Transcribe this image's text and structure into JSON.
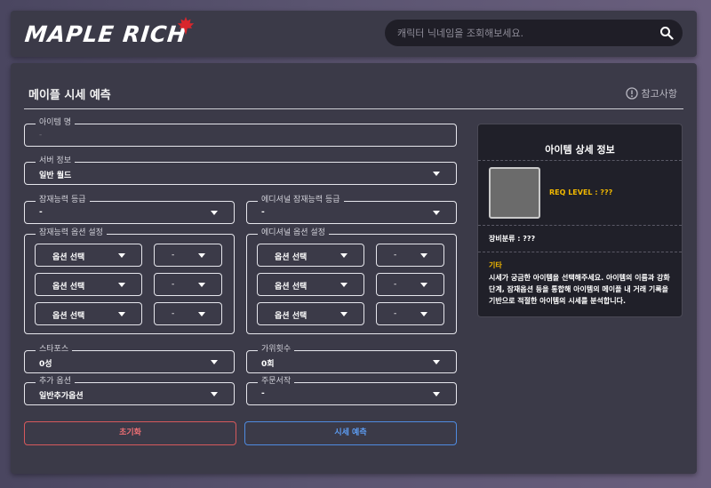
{
  "header": {
    "logo_text": "MAPLE RICH",
    "search": {
      "placeholder": "캐릭터 닉네임을 조회해보세요."
    }
  },
  "main": {
    "title": "메이플 시세 예측",
    "notice_label": "참고사항",
    "fields": {
      "item_name": {
        "label": "아이템 명",
        "value": "-"
      },
      "server": {
        "label": "서버 정보",
        "value": "일반 월드"
      },
      "potential_grade": {
        "label": "잠재능력 등급",
        "value": "-"
      },
      "additional_grade": {
        "label": "에디셔널 잠재능력 등급",
        "value": "-"
      },
      "starforce": {
        "label": "스타포스",
        "value": "0성"
      },
      "scissors": {
        "label": "가위횟수",
        "value": "0회"
      },
      "extra_option": {
        "label": "추가 옵션",
        "value": "일반추가옵션"
      },
      "scroll": {
        "label": "주문서작",
        "value": "-"
      }
    },
    "potential_group": {
      "label": "잠재능력 옵션 설정",
      "rows": [
        {
          "option": "옵션 선택",
          "value": "-"
        },
        {
          "option": "옵션 선택",
          "value": "-"
        },
        {
          "option": "옵션 선택",
          "value": "-"
        }
      ]
    },
    "additional_group": {
      "label": "에디셔널 옵션 설정",
      "rows": [
        {
          "option": "옵션 선택",
          "value": "-"
        },
        {
          "option": "옵션 선택",
          "value": "-"
        },
        {
          "option": "옵션 선택",
          "value": "-"
        }
      ]
    },
    "buttons": {
      "reset": "초기화",
      "predict": "시세 예측"
    }
  },
  "detail": {
    "title": "아이템 상세 정보",
    "req_level": "REQ LEVEL : ???",
    "equip_category": "장비분류 : ???",
    "etc_title": "기타",
    "etc_desc": "시세가 궁금한 아이템을 선택해주세요. 아이템의 이름과 강화 단계, 잠재옵션 등을 통합해 아이템의 메이플 내 거래 기록을 기반으로 적절한 아이템의 시세를 분석합니다."
  },
  "colors": {
    "accent_yellow": "#f1b800",
    "reset_red": "#ef6f74",
    "predict_blue": "#5c9cf2",
    "panel_bg": "#3b3a48"
  }
}
